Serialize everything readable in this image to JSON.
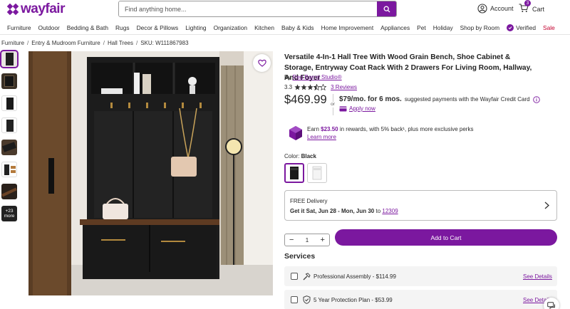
{
  "header": {
    "logo_text": "wayfair",
    "search_placeholder": "Find anything home...",
    "account_label": "Account",
    "cart_label": "Cart",
    "cart_count": "3"
  },
  "nav": {
    "items": [
      "Furniture",
      "Outdoor",
      "Bedding & Bath",
      "Rugs",
      "Decor & Pillows",
      "Lighting",
      "Organization",
      "Kitchen",
      "Baby & Kids",
      "Home Improvement",
      "Appliances",
      "Pet",
      "Holiday",
      "Shop by Room"
    ],
    "verified_label": "Verified",
    "sale_label": "Sale"
  },
  "breadcrumb": {
    "items": [
      "Furniture",
      "Entry & Mudroom Furniture",
      "Hall Trees"
    ],
    "sku": "SKU: W111867983"
  },
  "gallery": {
    "more_count": "+23",
    "more_label": "more"
  },
  "product": {
    "title": "Versatile 4-In-1 Hall Tree With Wood Grain Bench, Shoe Cabinet & Storage, Entryway Coat Rack With 2 Drawers For Living Room, Hallway, And Foyer",
    "by_prefix": "By",
    "brand": "Red Barrel Studio®",
    "rating": "3.3",
    "rating_value": 3.3,
    "reviews": "3 Reviews",
    "price": "$469.99",
    "or_label": "or",
    "monthly": "$79/mo. for 6 mos.",
    "monthly_suffix": "suggested payments with the Wayfair Credit Card",
    "apply_now": "Apply now"
  },
  "rewards": {
    "prefix": "Earn",
    "amount": "$23.50",
    "suffix": "in rewards, with 5% back¹, plus more exclusive perks",
    "learn_more": "Learn more"
  },
  "color": {
    "label": "Color:",
    "selected": "Black"
  },
  "delivery": {
    "free": "FREE Delivery",
    "get_it": "Get it Sat, Jun 28 - Mon, Jun 30",
    "to_label": "to",
    "zip": "12309"
  },
  "purchase": {
    "quantity": "1",
    "add_to_cart": "Add to Cart"
  },
  "services": {
    "heading": "Services",
    "items": [
      {
        "label": "Professional Assembly - $114.99",
        "link": "See Details"
      },
      {
        "label": "5 Year Protection Plan - $53.99",
        "link": "See Details"
      }
    ]
  },
  "colors": {
    "brand_purple": "#7b189f",
    "sale_red": "#c3002f"
  }
}
